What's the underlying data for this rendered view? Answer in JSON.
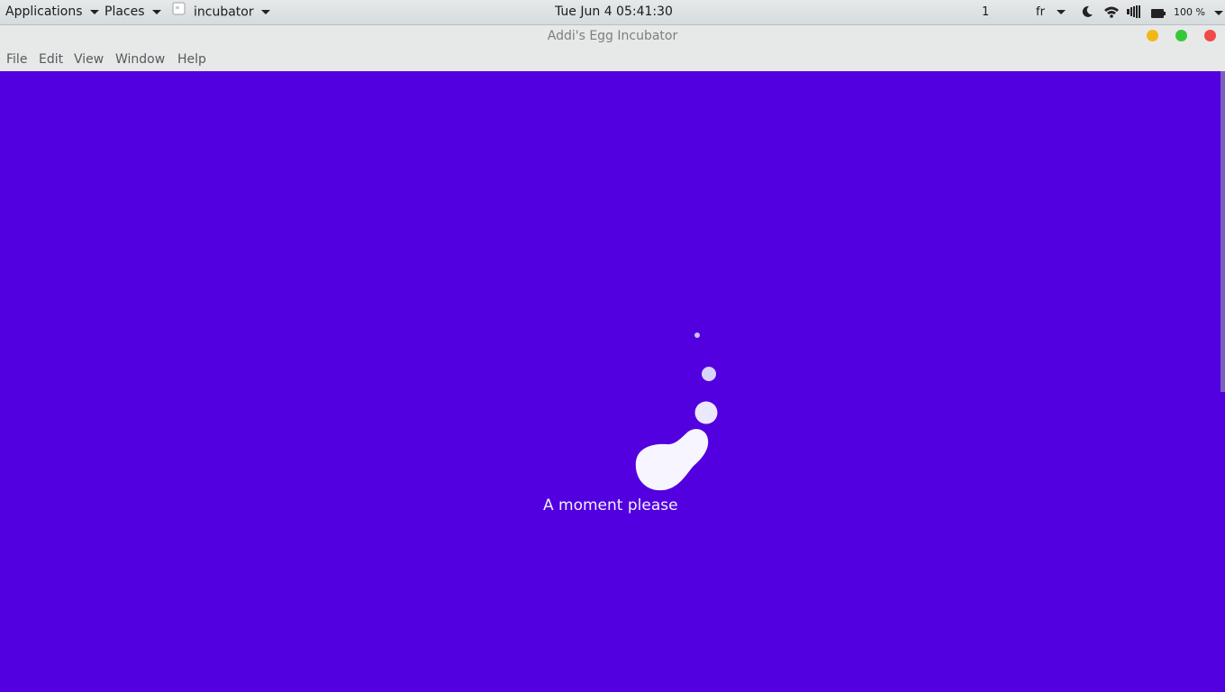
{
  "topbar": {
    "applications_label": "Applications",
    "places_label": "Places",
    "app_label": "incubator",
    "clock": "Tue Jun 4  05:41:30",
    "workspace": "1",
    "language": "fr",
    "battery_percent": "100 %",
    "icons": [
      "app-icon",
      "night-mode-icon",
      "wifi-icon",
      "volume-icon",
      "battery-icon"
    ]
  },
  "window": {
    "title": "Addi's Egg Incubator",
    "controls": {
      "minimize_color": "#f2b816",
      "maximize_color": "#35c93a",
      "close_color": "#f04a4a"
    },
    "menu": [
      "File",
      "Edit",
      "View",
      "Window",
      "Help"
    ]
  },
  "content": {
    "background_color": "#5200e0",
    "loading_text": "A moment please",
    "loader_icon": "blob-loader-icon"
  }
}
